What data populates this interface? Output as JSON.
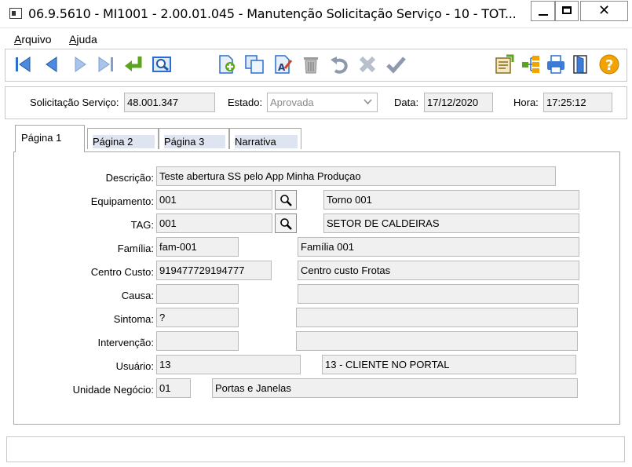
{
  "window": {
    "title": "06.9.5610 - MI1001 - 2.00.01.045 - Manutenção Solicitação Serviço - 10 - TOT...",
    "close_glyph": "✕"
  },
  "menu": {
    "items": [
      {
        "label_first": "A",
        "label_rest": "rquivo"
      },
      {
        "label_first": "A",
        "label_rest": "juda"
      }
    ]
  },
  "toolbar": {
    "icons": [
      "first-icon",
      "previous-icon",
      "next-icon",
      "last-icon",
      "goto-icon",
      "search-icon",
      "add-icon",
      "copy-icon",
      "edit-icon",
      "delete-icon",
      "undo-icon",
      "cancel-icon",
      "save-icon",
      "report-icon",
      "tree-icon",
      "print-icon",
      "exit-icon",
      "help-icon"
    ],
    "colors": {
      "nav_blue": "#2a6fd0",
      "nav_light": "#8fb3e6",
      "green": "#5aa51c",
      "gray": "#9a9a9a",
      "blue": "#3e7bd6",
      "orange": "#f2a300"
    },
    "help_glyph": "?"
  },
  "header": {
    "solicitacao_label": "Solicitação Serviço:",
    "solicitacao_value": "48.001.347",
    "estado_label": "Estado:",
    "estado_value": "Aprovada",
    "data_label": "Data:",
    "data_value": "17/12/2020",
    "hora_label": "Hora:",
    "hora_value": "17:25:12"
  },
  "tabs": [
    {
      "label": "Página 1",
      "active": true
    },
    {
      "label": "Página 2"
    },
    {
      "label": "Página 3"
    },
    {
      "label": "Narrativa"
    }
  ],
  "form": {
    "descricao_label": "Descrição:",
    "descricao_value": "Teste abertura SS pelo App Minha Produçao",
    "equipamento_label": "Equipamento:",
    "equipamento_code": "001",
    "equipamento_desc": "Torno 001",
    "tag_label": "TAG:",
    "tag_code": "001",
    "tag_desc": "SETOR DE CALDEIRAS",
    "familia_label": "Família:",
    "familia_code": "fam-001",
    "familia_desc": "Família 001",
    "centro_label": "Centro Custo:",
    "centro_code": "919477729194777",
    "centro_desc": "Centro custo Frotas",
    "causa_label": "Causa:",
    "causa_code": "",
    "causa_desc": "",
    "sintoma_label": "Sintoma:",
    "sintoma_code": "?",
    "sintoma_desc": "",
    "intervencao_label": "Intervenção:",
    "intervencao_code": "",
    "intervencao_desc": "",
    "usuario_label": "Usuário:",
    "usuario_code": "13",
    "usuario_desc": "13 - CLIENTE NO PORTAL",
    "unidade_label": "Unidade Negócio:",
    "unidade_code": "01",
    "unidade_desc": "Portas e Janelas"
  },
  "status": {
    "text": ""
  }
}
